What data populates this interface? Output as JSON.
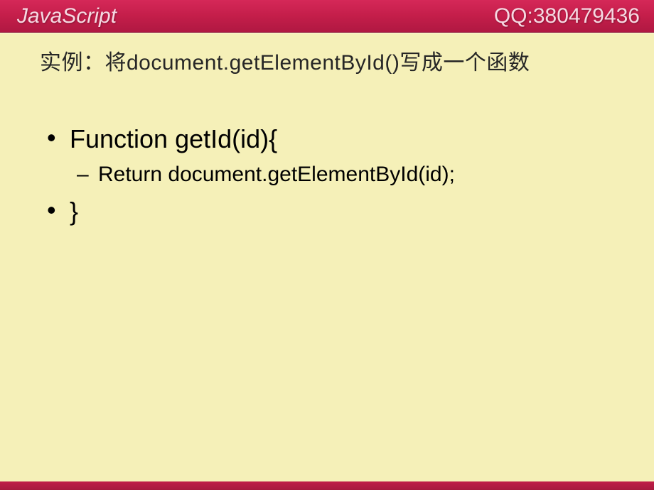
{
  "header": {
    "title": "JavaScript",
    "qq": "QQ:380479436"
  },
  "slide": {
    "title": "实例：将document.getElementById()写成一个函数",
    "bullets": [
      {
        "level": 1,
        "text": "Function getId(id){"
      },
      {
        "level": 2,
        "text": "Return document.getElementById(id);"
      },
      {
        "level": 1,
        "text": "}"
      }
    ]
  }
}
